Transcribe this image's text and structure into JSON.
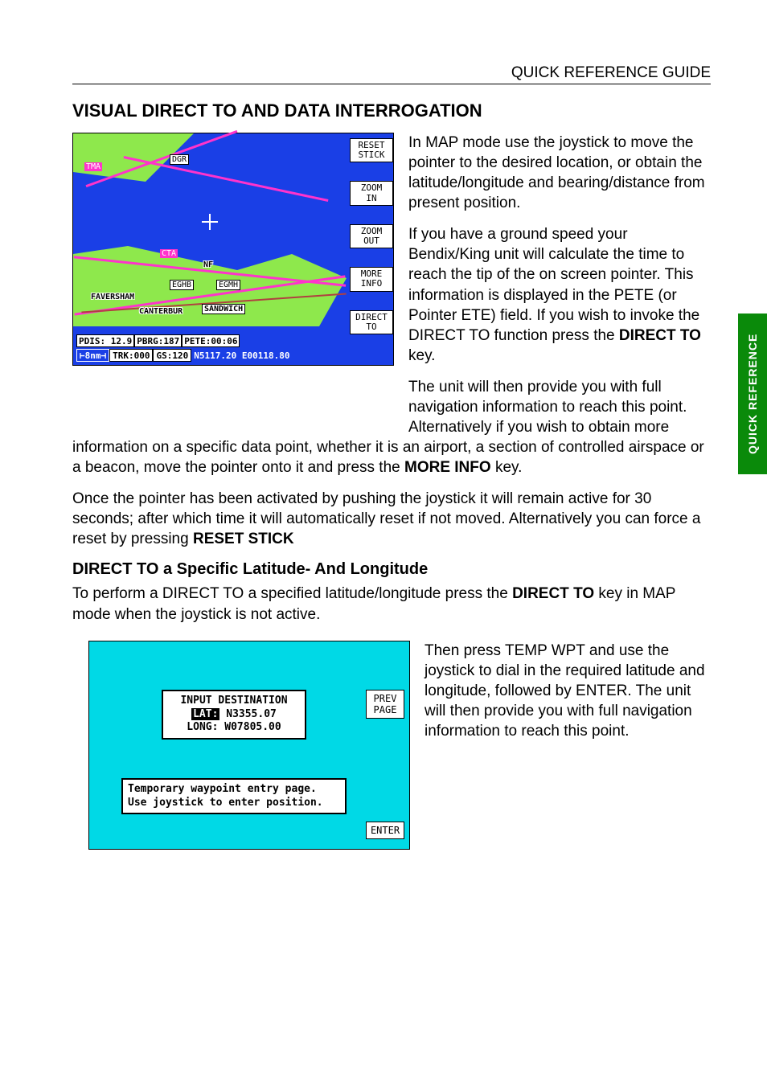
{
  "header": {
    "title": "QUICK REFERENCE GUIDE"
  },
  "section": {
    "title": "VISUAL DIRECT TO AND DATA INTERROGATION",
    "subtitle": "DIRECT TO a Specific Latitude- And Longitude"
  },
  "sidebar_tab": "QUICK REFERENCE",
  "para": {
    "p1": "In MAP mode use the joystick to move the pointer to the desired location, or obtain the latitude/longitude and bearing/distance from present position.",
    "p2_a": "If you have a ground speed your Bendix/King unit will calculate the time to reach the tip of the on screen pointer. This information is displayed in the PETE (or Pointer ETE) field.  If you wish to invoke the DIRECT TO function press the ",
    "p2_bold": "DIRECT TO",
    "p2_b": " key.",
    "p3_a": "The unit will then provide you with full navigation information to reach this point. Alternatively if you wish to obtain more information on a specific data point, whether it is an airport, a section of controlled airspace or a beacon, move the pointer onto it and press the ",
    "p3_bold": "MORE INFO",
    "p3_b": " key.",
    "p3_wrap_a": "The unit will then provide you with full navigation information to reach this point. Alternatively if you wish to obtain more",
    "p3_wrap_b_a": "information on a specific data point, whether it is an airport, a section of controlled airspace or a beacon, move the pointer onto it and press the ",
    "p4_a": "Once the pointer has been activated by pushing the joystick it will remain active for 30 seconds; after which time it will automatically reset if not moved. Alternatively you can force a reset by pressing ",
    "p4_bold": "RESET STICK",
    "p5_a": "To perform a DIRECT TO a specified latitude/longitude press the ",
    "p5_bold": "DIRECT TO",
    "p5_b": " key in MAP mode when the joystick is not active.",
    "p6": "Then press TEMP WPT and use the joystick to dial in the required latitude and longitude, followed by ENTER.  The unit will then provide you with full navigation information to reach this point."
  },
  "screenshot1": {
    "tags": {
      "tma": "TMA",
      "dgr": "DGR",
      "cta": "CTA",
      "nf": "NF",
      "eghb": "EGHB",
      "egmh": "EGMH",
      "faversham": "FAVERSHAM",
      "canterbur": "CANTERBUR",
      "sandwich": "SANDWICH"
    },
    "softkeys": {
      "reset_stick": "RESET\nSTICK",
      "zoom_in": "ZOOM\nIN",
      "zoom_out": "ZOOM\nOUT",
      "more_info": "MORE\nINFO",
      "direct_to": "DIRECT\nTO"
    },
    "status1": {
      "pdis": "PDIS: 12.9",
      "pbrg": "PBRG:187",
      "pete": "PETE:00:06"
    },
    "status2": {
      "scale": "8nm",
      "trk": "TRK:000",
      "gs": "GS:120",
      "pos": "N5117.20 E00118.80"
    }
  },
  "screenshot2": {
    "input": {
      "title": "INPUT DESTINATION",
      "lat_label": "LAT:",
      "lat_value": "N3355.07",
      "long": "LONG: W07805.00"
    },
    "help": {
      "line1": "Temporary waypoint entry page.",
      "line2": "Use joystick to enter position."
    },
    "softkeys": {
      "prev_page": "PREV\nPAGE",
      "enter": "ENTER"
    }
  }
}
